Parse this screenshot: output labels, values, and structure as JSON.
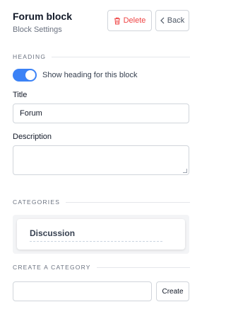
{
  "header": {
    "title": "Forum block",
    "subtitle": "Block Settings",
    "delete_label": "Delete",
    "back_label": "Back"
  },
  "heading_section": {
    "label": "HEADING",
    "toggle_label": "Show heading for this block",
    "toggle_on": true
  },
  "title_field": {
    "label": "Title",
    "value": "Forum"
  },
  "description_field": {
    "label": "Description",
    "value": ""
  },
  "categories_section": {
    "label": "CATEGORIES",
    "items": [
      "Discussion"
    ]
  },
  "create_section": {
    "label": "CREATE A CATEGORY",
    "input_value": "",
    "button_label": "Create"
  },
  "colors": {
    "accent": "#3b82f6",
    "danger": "#ef4444"
  }
}
